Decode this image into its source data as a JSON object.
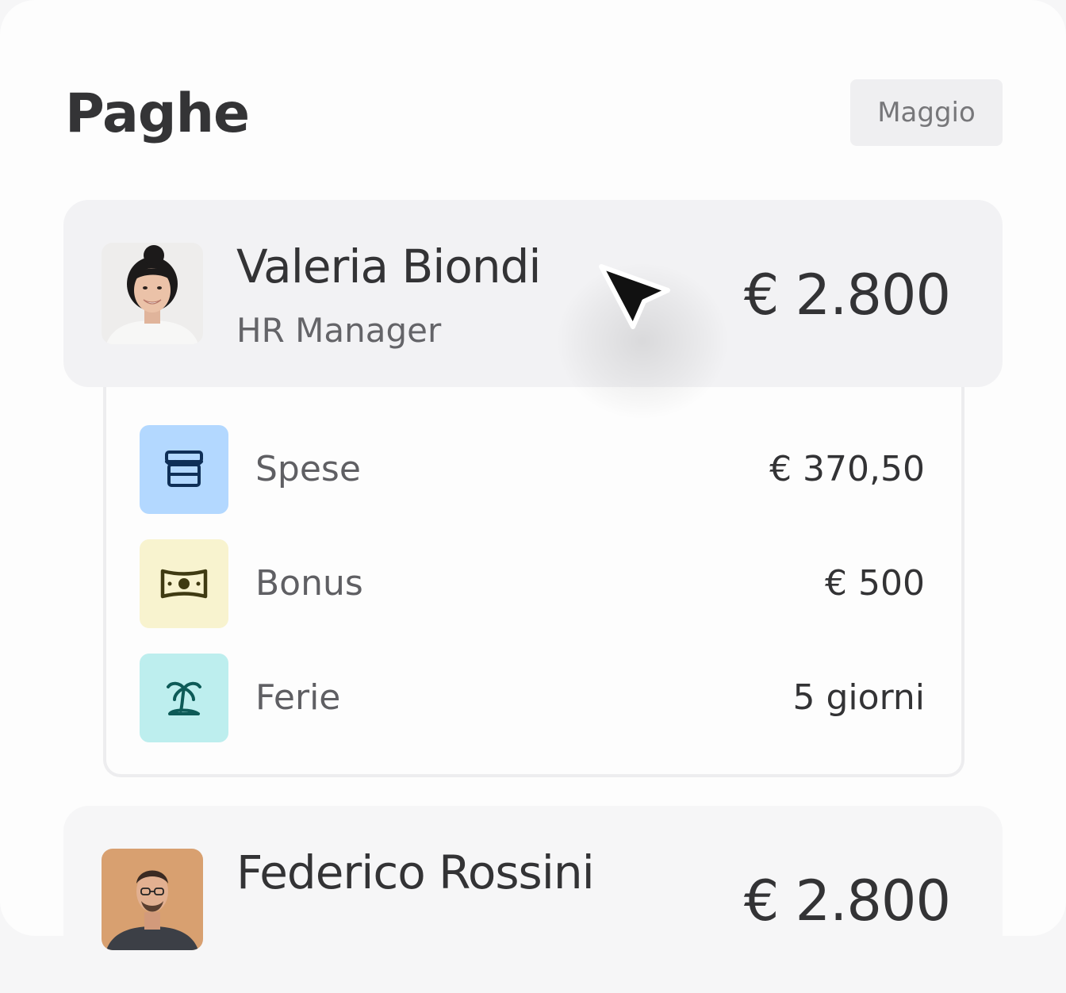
{
  "page": {
    "title": "Paghe",
    "month_button": "Maggio"
  },
  "employees": [
    {
      "name": "Valeria Biondi",
      "role": "HR Manager",
      "amount": "€ 2.800",
      "avatar_bg": "#eeedec",
      "details": [
        {
          "icon": "store-icon",
          "label": "Spese",
          "value": "€ 370,50",
          "icon_bg": "#b3d8ff",
          "icon_color": "#0f2f57"
        },
        {
          "icon": "banknote-icon",
          "label": "Bonus",
          "value": "€ 500",
          "icon_bg": "#f8f3cf",
          "icon_color": "#3f3a12"
        },
        {
          "icon": "palm-tree-icon",
          "label": "Ferie",
          "value": "5 giorni",
          "icon_bg": "#bdeeee",
          "icon_color": "#0d5a57"
        }
      ]
    },
    {
      "name": "Federico Rossini",
      "amount": "€ 2.800",
      "avatar_bg": "#d8a070"
    }
  ],
  "colors": {
    "background": "#fdfdfd",
    "card": "#f2f2f4",
    "text_primary": "#333335",
    "text_secondary": "#646468",
    "cursor": "#111111"
  }
}
